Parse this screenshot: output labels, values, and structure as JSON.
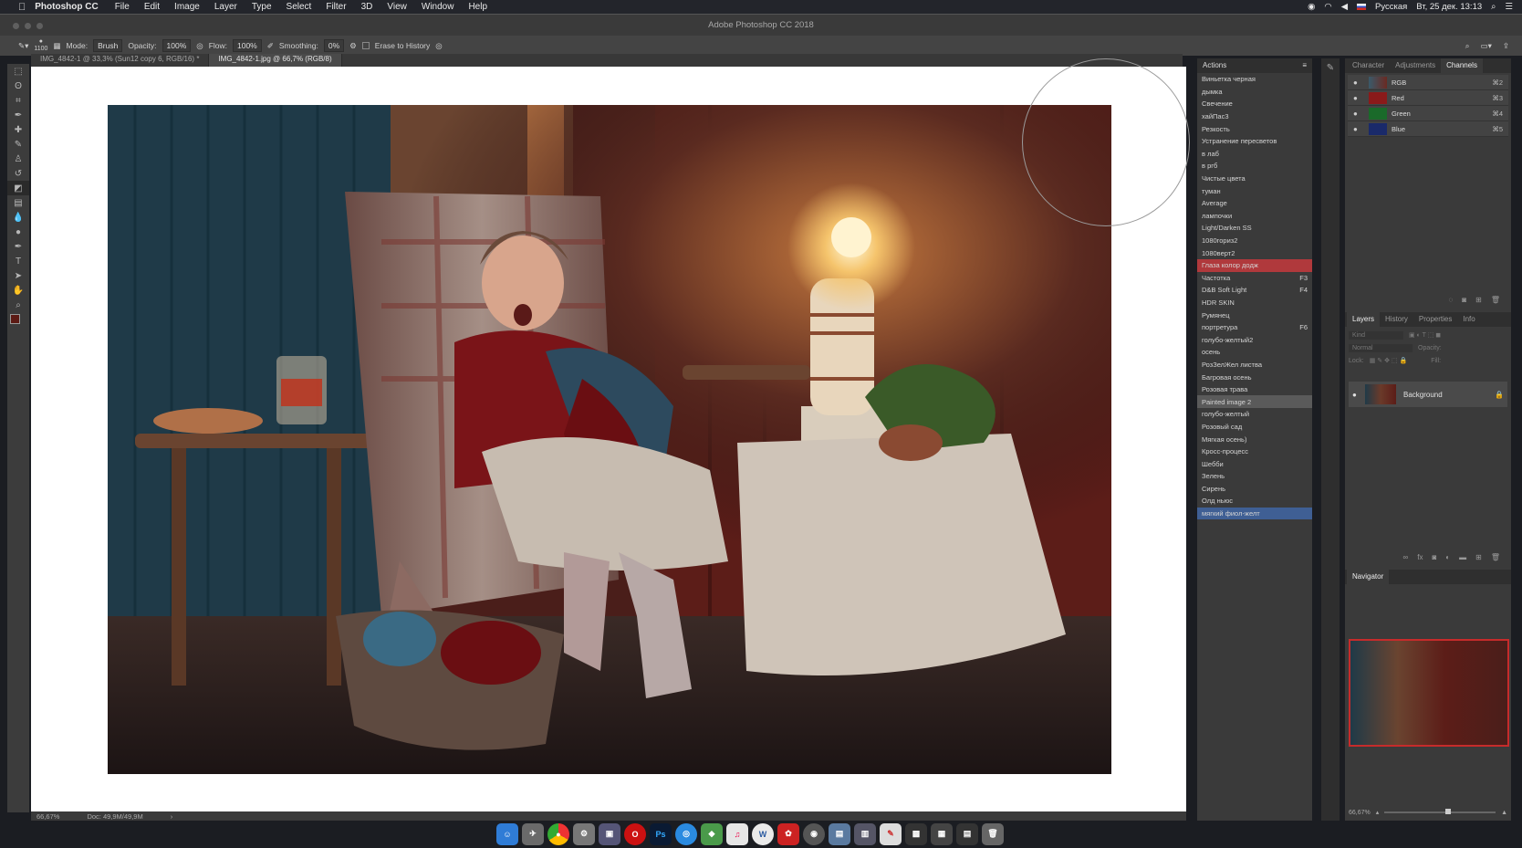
{
  "menubar": {
    "app": "Photoshop CC",
    "items": [
      "File",
      "Edit",
      "Image",
      "Layer",
      "Type",
      "Select",
      "Filter",
      "3D",
      "View",
      "Window",
      "Help"
    ],
    "language": "Русская",
    "datetime": "Вт, 25 дек.  13:13"
  },
  "window": {
    "title": "Adobe Photoshop CC 2018"
  },
  "options": {
    "brush_size": "1100",
    "mode_label": "Mode:",
    "mode_value": "Brush",
    "opacity_label": "Opacity:",
    "opacity_value": "100%",
    "flow_label": "Flow:",
    "flow_value": "100%",
    "smoothing_label": "Smoothing:",
    "smoothing_value": "0%",
    "erase_label": "Erase to History"
  },
  "doc_tabs": [
    "IMG_4842-1 @ 33,3% (Sun12 copy 6, RGB/16) *",
    "IMG_4842-1.jpg @ 66,7% (RGB/8)"
  ],
  "status": {
    "zoom": "66,67%",
    "doc": "Doc: 49,9M/49,9M"
  },
  "actions_panel": {
    "title": "Actions",
    "items": [
      {
        "label": "Виньетка черная",
        "key": ""
      },
      {
        "label": "дымка",
        "key": ""
      },
      {
        "label": "Свечение",
        "key": ""
      },
      {
        "label": "хайПас3",
        "key": ""
      },
      {
        "label": "Резкость",
        "key": ""
      },
      {
        "label": "Устранение пересветов",
        "key": ""
      },
      {
        "label": "в лаб",
        "key": ""
      },
      {
        "label": "в ргб",
        "key": ""
      },
      {
        "label": "Чистые цвета",
        "key": ""
      },
      {
        "label": "туман",
        "key": ""
      },
      {
        "label": "Average",
        "key": ""
      },
      {
        "label": "лампочки",
        "key": ""
      },
      {
        "label": "Light/Darken SS",
        "key": ""
      },
      {
        "label": "1080гориз2",
        "key": ""
      },
      {
        "label": "1080верт2",
        "key": ""
      },
      {
        "label": "Глаза колор додж",
        "key": ""
      },
      {
        "label": "Частотка",
        "key": "F3"
      },
      {
        "label": "D&B Soft Light",
        "key": "F4"
      },
      {
        "label": "HDR SKIN",
        "key": ""
      },
      {
        "label": "Румянец",
        "key": ""
      },
      {
        "label": "портретура",
        "key": "F6"
      },
      {
        "label": "голубо-желтый2",
        "key": ""
      },
      {
        "label": "осень",
        "key": ""
      },
      {
        "label": "РозЗелЖел листва",
        "key": ""
      },
      {
        "label": "Багровая осень",
        "key": ""
      },
      {
        "label": "Розовая трава",
        "key": ""
      },
      {
        "label": "Painted image 2",
        "key": ""
      },
      {
        "label": "голубо-желтый",
        "key": ""
      },
      {
        "label": "Розовый сад",
        "key": ""
      },
      {
        "label": "Мягкая осень)",
        "key": ""
      },
      {
        "label": "Кросс-процесс",
        "key": ""
      },
      {
        "label": "Шебби",
        "key": ""
      },
      {
        "label": "Зелень",
        "key": ""
      },
      {
        "label": "Сирень",
        "key": ""
      },
      {
        "label": "Олд ньюс",
        "key": ""
      },
      {
        "label": "мягкий фиол-желт",
        "key": ""
      }
    ],
    "highlight_red_index": 15,
    "highlight_gray_index": 26,
    "selected_index": 35
  },
  "top_panel": {
    "tabs": [
      "Character",
      "Adjustments",
      "Channels"
    ],
    "channels": [
      {
        "name": "RGB",
        "key": "⌘2"
      },
      {
        "name": "Red",
        "key": "⌘3"
      },
      {
        "name": "Green",
        "key": "⌘4"
      },
      {
        "name": "Blue",
        "key": "⌘5"
      }
    ]
  },
  "layers_panel": {
    "tabs": [
      "Layers",
      "History",
      "Properties",
      "Info"
    ],
    "kind": "Kind",
    "blend": "Normal",
    "opacity_label": "Opacity:",
    "lock_label": "Lock:",
    "fill_label": "Fill:",
    "layer_name": "Background"
  },
  "navigator": {
    "title": "Navigator",
    "zoom": "66,67%"
  },
  "colors": {
    "accent_red": "#b0393c",
    "selected_blue": "#3f5f94"
  }
}
